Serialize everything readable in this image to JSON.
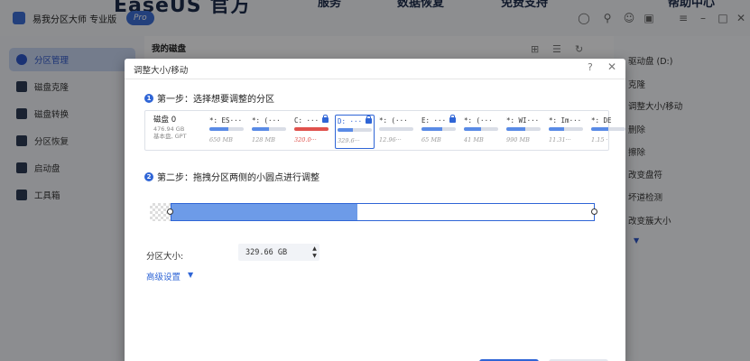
{
  "app": {
    "title": "易我分区大师 专业版",
    "edition": "Pro",
    "promo": "EaseUS 官方",
    "top_nav": [
      "服务",
      "数据恢复",
      "免费支持",
      "帮助中心"
    ]
  },
  "sidebar": {
    "items": [
      {
        "label": "分区管理",
        "active": true,
        "icon": "partition-icon"
      },
      {
        "label": "磁盘克隆",
        "active": false,
        "icon": "clone-icon"
      },
      {
        "label": "磁盘转换",
        "active": false,
        "icon": "convert-icon"
      },
      {
        "label": "分区恢复",
        "active": false,
        "icon": "recover-icon"
      },
      {
        "label": "启动盘",
        "active": false,
        "icon": "boot-disk-icon"
      },
      {
        "label": "工具箱",
        "active": false,
        "icon": "toolbox-icon"
      }
    ]
  },
  "main": {
    "heading": "我的磁盘"
  },
  "right_panel": {
    "items": [
      "驱动盘 (D:)",
      "克隆",
      "调整大小/移动",
      "删除",
      "擦除",
      "改变盘符",
      "坏道检测",
      "改变簇大小"
    ]
  },
  "dialog": {
    "title": "调整大小/移动",
    "step1": {
      "number": "1",
      "label": "第一步：选择想要调整的分区"
    },
    "step2": {
      "number": "2",
      "label": "第二步：拖拽分区两侧的小圆点进行调整"
    },
    "disk": {
      "name": "磁盘 0",
      "size": "476.94 GB",
      "type": "基本盘, GPT"
    },
    "partitions": [
      {
        "label": "*: ES···",
        "size": "650 MB",
        "usage": 0.55,
        "locked": false,
        "selected": false,
        "color": "blue"
      },
      {
        "label": "*: (···",
        "size": "128 MB",
        "usage": 0.5,
        "locked": false,
        "selected": false,
        "color": "blue"
      },
      {
        "label": "C: ···",
        "size": "320.0···",
        "usage": 1.0,
        "locked": true,
        "selected": false,
        "color": "red"
      },
      {
        "label": "D: ···",
        "size": "329.6···",
        "usage": 0.45,
        "locked": true,
        "selected": true,
        "color": "blue"
      },
      {
        "label": "*: (···",
        "size": "12.96···",
        "usage": 0.0,
        "locked": false,
        "selected": false,
        "color": "blue"
      },
      {
        "label": "E: ···",
        "size": "65 MB",
        "usage": 0.6,
        "locked": true,
        "selected": false,
        "color": "blue"
      },
      {
        "label": "*: (···",
        "size": "41 MB",
        "usage": 0.5,
        "locked": false,
        "selected": false,
        "color": "blue"
      },
      {
        "label": "*: WI···",
        "size": "990 MB",
        "usage": 0.55,
        "locked": false,
        "selected": false,
        "color": "blue"
      },
      {
        "label": "*: Im···",
        "size": "11.31···",
        "usage": 0.45,
        "locked": false,
        "selected": false,
        "color": "blue"
      },
      {
        "label": "*: DE",
        "size": "1.15 ·",
        "usage": 0.5,
        "locked": false,
        "selected": false,
        "color": "blue"
      }
    ],
    "resize": {
      "used_fraction": 0.44
    },
    "size_label": "分区大小:",
    "size_value": "329.66 GB",
    "advanced": "高级设置"
  },
  "colors": {
    "accent": "#2f65d6",
    "used": "#6d9be8",
    "system_partition": "#e0524d"
  }
}
